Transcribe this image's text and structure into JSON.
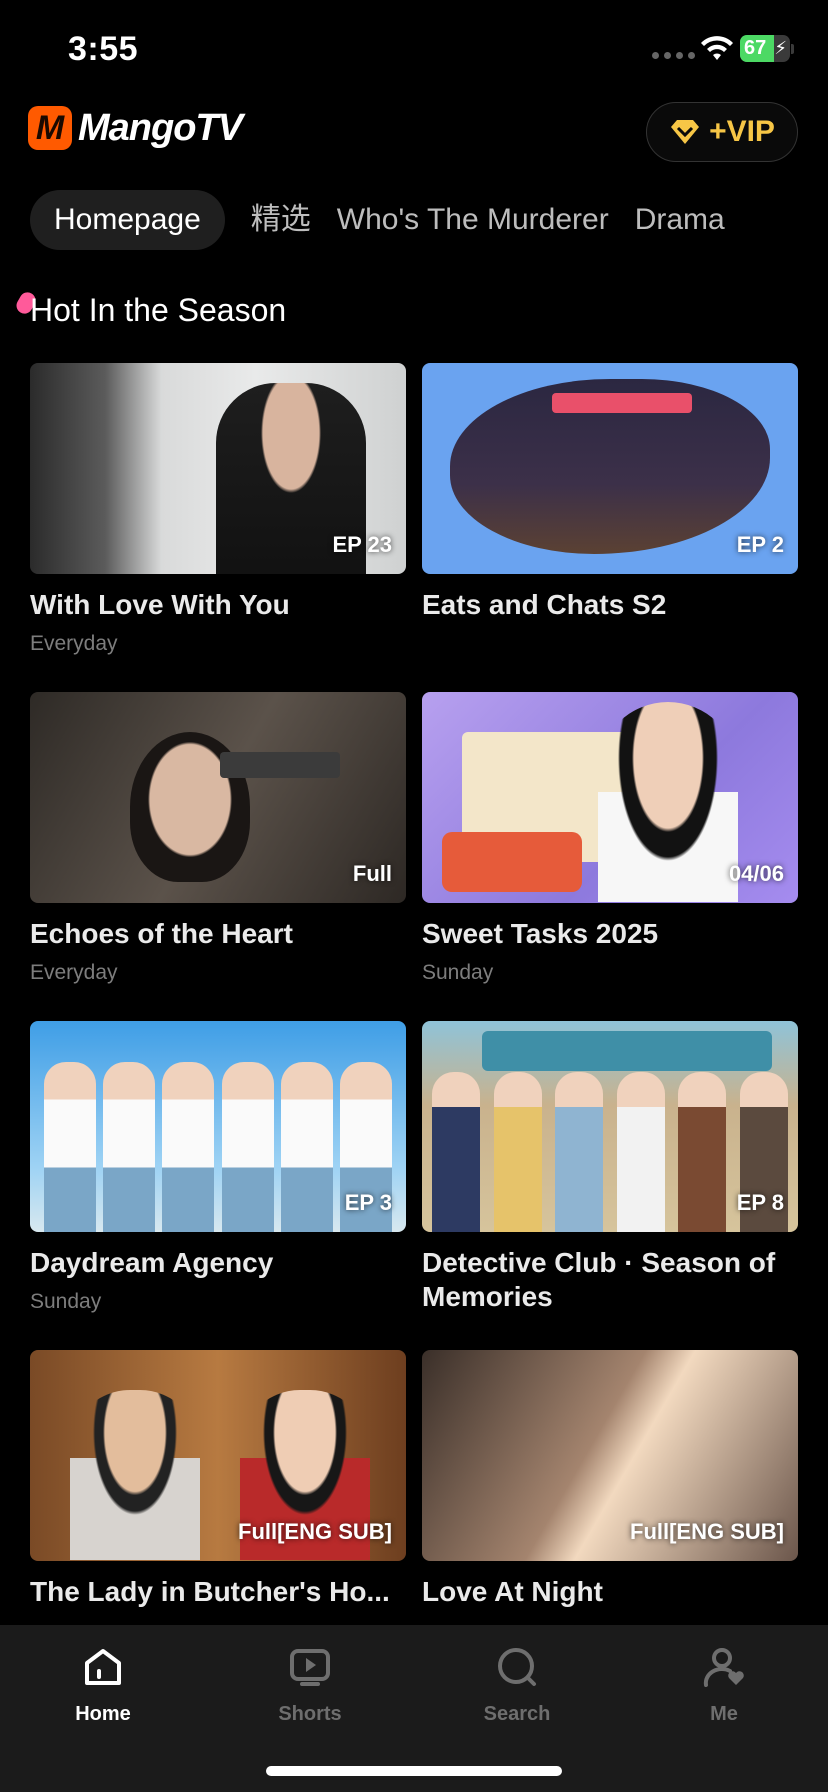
{
  "status_bar": {
    "time": "3:55",
    "battery_percent": "67",
    "battery_level": 0.67
  },
  "header": {
    "logo_text": "MangoTV",
    "logo_mark": "M",
    "vip_label": "+VIP",
    "vip_icon": "diamond-icon"
  },
  "tabs": [
    {
      "label": "Homepage",
      "active": true
    },
    {
      "label": "精选",
      "active": false
    },
    {
      "label": "Who's The Murderer",
      "active": false
    },
    {
      "label": "Drama",
      "active": false
    }
  ],
  "section": {
    "title": "Hot In the Season"
  },
  "cards": [
    {
      "title": "With Love With You",
      "badge": "EP 23",
      "subtitle": "Everyday"
    },
    {
      "title": "Eats and Chats S2",
      "badge": "EP 2",
      "subtitle": ""
    },
    {
      "title": "Echoes of the Heart",
      "badge": "Full",
      "subtitle": "Everyday"
    },
    {
      "title": "Sweet Tasks 2025",
      "badge": "04/06",
      "subtitle": "Sunday"
    },
    {
      "title": "Daydream Agency",
      "badge": "EP 3",
      "subtitle": "Sunday"
    },
    {
      "title": " Detective Club · Season of Memories",
      "badge": "EP 8",
      "subtitle": ""
    },
    {
      "title": "The Lady in Butcher's Ho...",
      "badge": "Full[ENG SUB]",
      "subtitle": ""
    },
    {
      "title": "Love At Night",
      "badge": "Full[ENG SUB]",
      "subtitle": ""
    }
  ],
  "bottom_nav": [
    {
      "label": "Home",
      "icon": "home-icon",
      "active": true
    },
    {
      "label": "Shorts",
      "icon": "play-icon",
      "active": false
    },
    {
      "label": "Search",
      "icon": "search-icon",
      "active": false
    },
    {
      "label": "Me",
      "icon": "profile-icon",
      "active": false
    }
  ],
  "colors": {
    "brand": "#ff5a00",
    "vip_gold": "#f7c646",
    "battery_green": "#4cd964"
  }
}
